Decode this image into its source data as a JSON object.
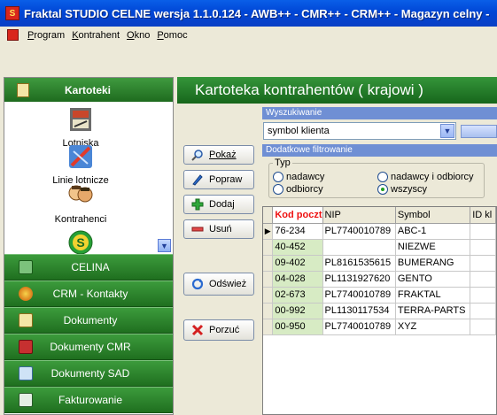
{
  "window": {
    "title": "Fraktal STUDIO CELNE   wersja 1.1.0.124 - AWB++ - CMR++ - CRM++ - Magazyn celny -"
  },
  "menu": [
    "Program",
    "Kontrahent",
    "Okno",
    "Pomoc"
  ],
  "sidebar": {
    "title": "Kartoteki",
    "entries": [
      {
        "label": "Lotniska",
        "icon": "airports-icon"
      },
      {
        "label": "Linie lotnicze",
        "icon": "airlines-icon"
      },
      {
        "label": "Kontrahenci",
        "icon": "contractors-icon"
      }
    ],
    "modules": [
      {
        "label": "CELINA",
        "color": "#2f8c2f"
      },
      {
        "label": "CRM - Kontakty",
        "color": "#d87a1a"
      },
      {
        "label": "Dokumenty",
        "color": "#e8d070"
      },
      {
        "label": "Dokumenty CMR",
        "color": "#c63030"
      },
      {
        "label": "Dokumenty SAD",
        "color": "#7fb2e0"
      },
      {
        "label": "Fakturowanie",
        "color": "#4b8a4b"
      }
    ]
  },
  "main": {
    "title": "Kartoteka kontrahentów ( krajowi )",
    "buttons": {
      "show": "Pokaż",
      "edit": "Popraw",
      "add": "Dodaj",
      "delete": "Usuń",
      "refresh": "Odśwież",
      "cancel": "Porzuć"
    },
    "search": {
      "header": "Wyszukiwanie",
      "field": "symbol klienta"
    },
    "filter": {
      "header": "Dodatkowe filtrowanie",
      "group_label": "Typ",
      "options": [
        "nadawcy",
        "odbiorcy",
        "nadawcy i odbiorcy",
        "wszyscy"
      ],
      "selected": "wszyscy"
    },
    "grid": {
      "columns": [
        "Kod poczt",
        "NIP",
        "Symbol",
        "ID kl"
      ],
      "rows": [
        [
          "76-234",
          "PL7740010789",
          "ABC-1",
          ""
        ],
        [
          "40-452",
          "",
          "NIEZWE",
          ""
        ],
        [
          "09-402",
          "PL8161535615",
          "BUMERANG",
          ""
        ],
        [
          "04-028",
          "PL1131927620",
          "GENTO",
          ""
        ],
        [
          "02-673",
          "PL7740010789",
          "FRAKTAL",
          ""
        ],
        [
          "00-992",
          "PL1130117534",
          "TERRA-PARTS",
          ""
        ],
        [
          "00-950",
          "PL7740010789",
          "XYZ",
          ""
        ]
      ]
    }
  }
}
